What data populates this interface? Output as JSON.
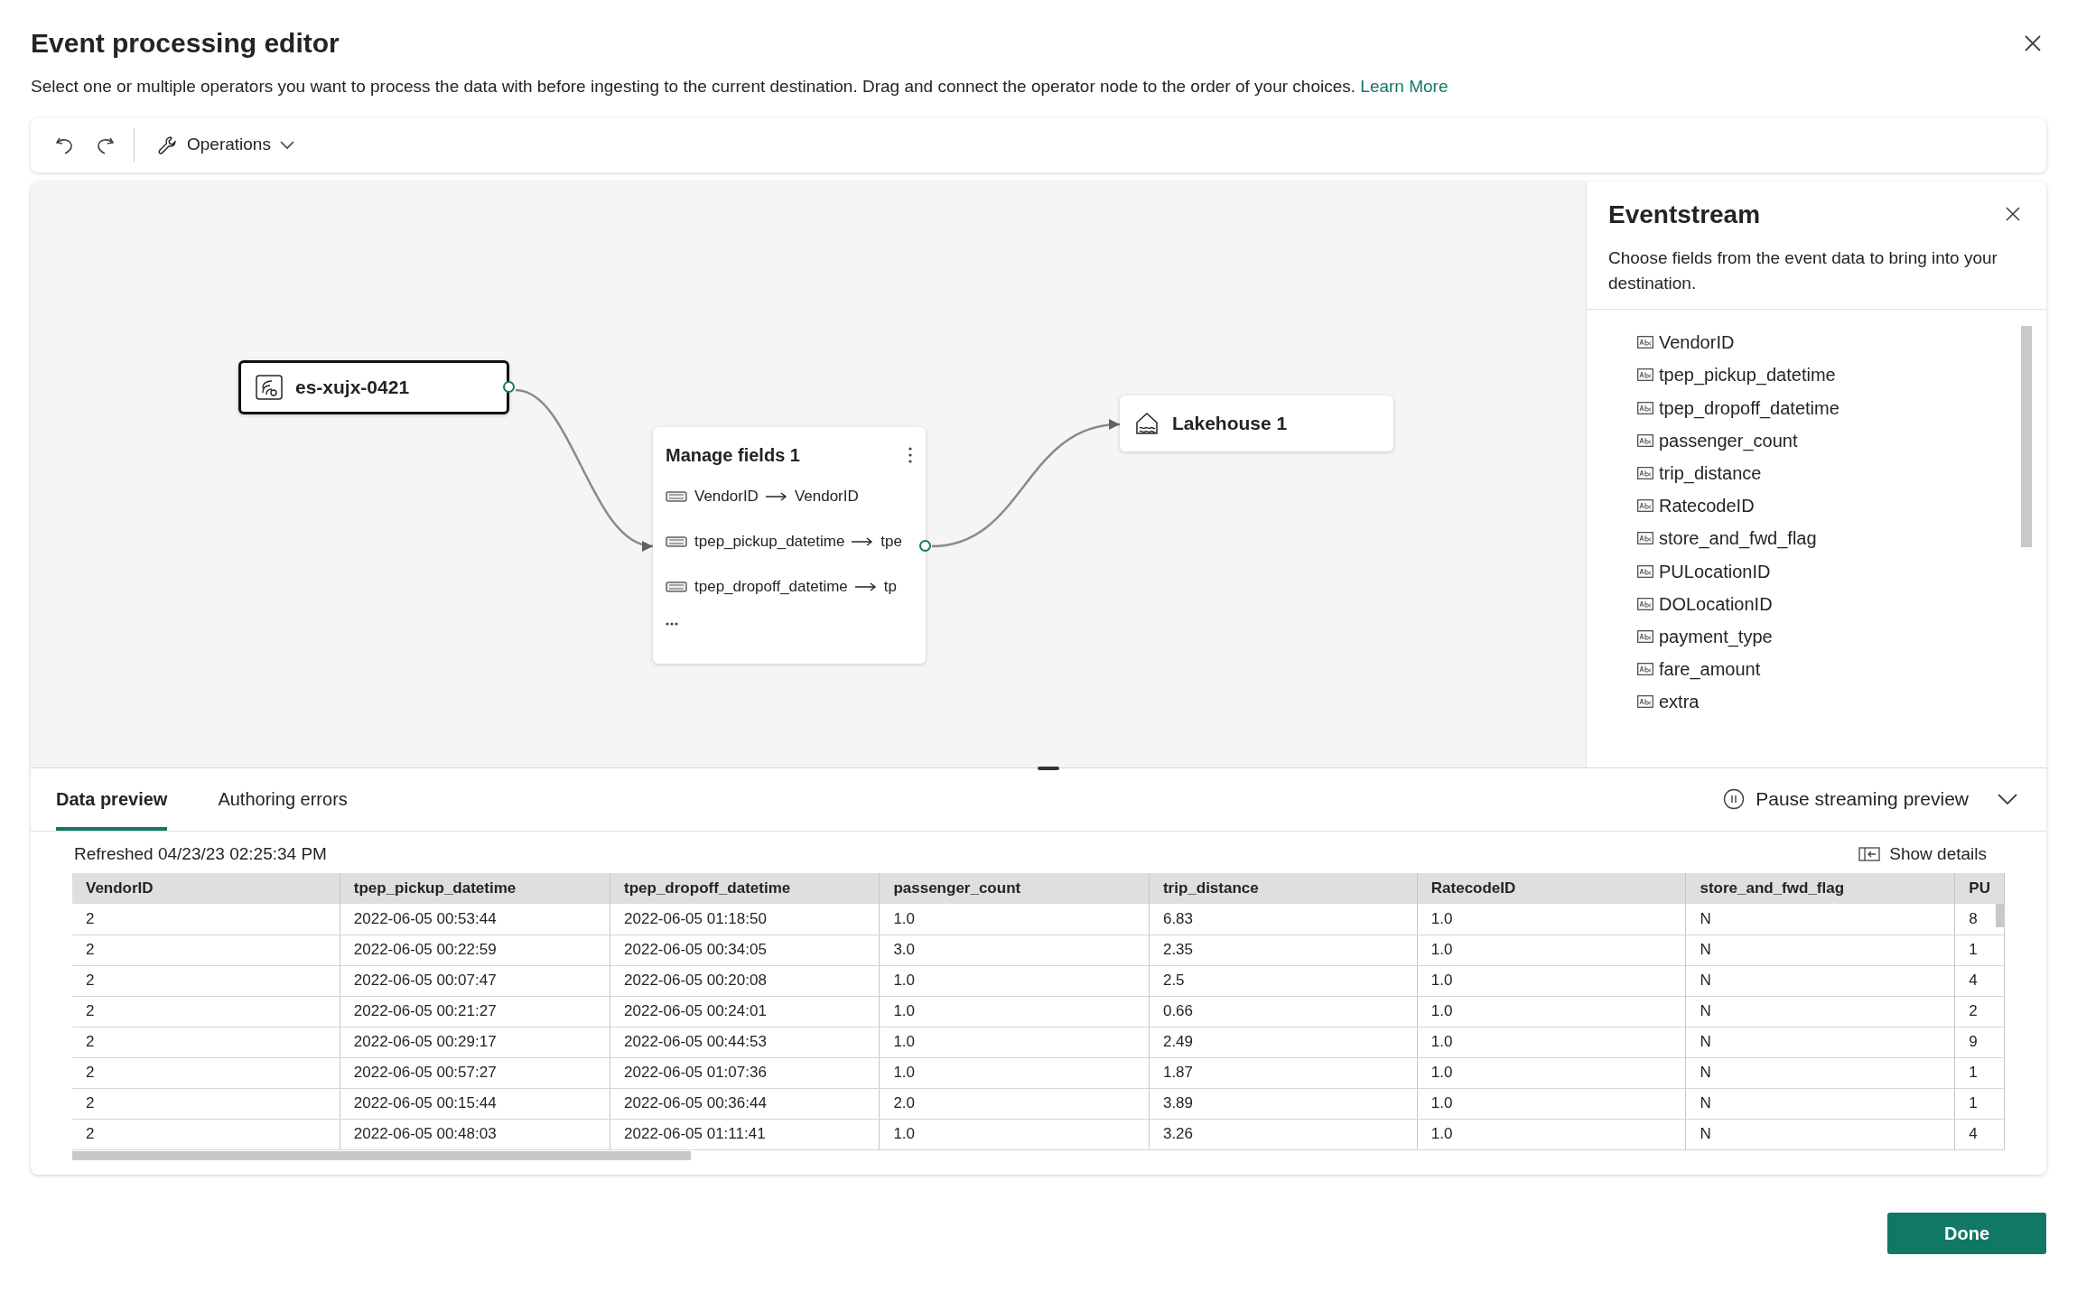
{
  "dialog": {
    "title": "Event processing editor",
    "description": "Select one or multiple operators you want to process the data with before ingesting to the current destination. Drag and connect the operator node to the order of your choices.",
    "learn_more": "Learn More"
  },
  "toolbar": {
    "operations": "Operations"
  },
  "canvas": {
    "nodes": [
      {
        "kind": "source",
        "label": "es-xujx-0421",
        "selected": true
      },
      {
        "kind": "operator",
        "label": "Manage fields 1",
        "selected": false,
        "fields": [
          {
            "source": "VendorID",
            "target": "VendorID"
          },
          {
            "source": "tpep_pickup_datetime",
            "target": "tpe"
          },
          {
            "source": "tpep_dropoff_datetime",
            "target": "tp"
          }
        ]
      },
      {
        "kind": "destination",
        "label": "Lakehouse 1",
        "selected": false
      }
    ]
  },
  "side_panel": {
    "title": "Eventstream",
    "description": "Choose fields from the event data to bring into your destination.",
    "fields": [
      "VendorID",
      "tpep_pickup_datetime",
      "tpep_dropoff_datetime",
      "passenger_count",
      "trip_distance",
      "RatecodeID",
      "store_and_fwd_flag",
      "PULocationID",
      "DOLocationID",
      "payment_type",
      "fare_amount",
      "extra"
    ]
  },
  "bottom_panel": {
    "tabs": [
      {
        "label": "Data preview",
        "selected": true
      },
      {
        "label": "Authoring errors",
        "selected": false
      }
    ],
    "pause": "Pause streaming preview",
    "refreshed": "Refreshed 04/23/23 02:25:34 PM",
    "show_details": "Show details",
    "table": {
      "columns": [
        "VendorID",
        "tpep_pickup_datetime",
        "tpep_dropoff_datetime",
        "passenger_count",
        "trip_distance",
        "RatecodeID",
        "store_and_fwd_flag",
        "PU"
      ],
      "rows": [
        [
          "2",
          "2022-06-05 00:53:44",
          "2022-06-05 01:18:50",
          "1.0",
          "6.83",
          "1.0",
          "N",
          "8"
        ],
        [
          "2",
          "2022-06-05 00:22:59",
          "2022-06-05 00:34:05",
          "3.0",
          "2.35",
          "1.0",
          "N",
          "1"
        ],
        [
          "2",
          "2022-06-05 00:07:47",
          "2022-06-05 00:20:08",
          "1.0",
          "2.5",
          "1.0",
          "N",
          "4"
        ],
        [
          "2",
          "2022-06-05 00:21:27",
          "2022-06-05 00:24:01",
          "1.0",
          "0.66",
          "1.0",
          "N",
          "2"
        ],
        [
          "2",
          "2022-06-05 00:29:17",
          "2022-06-05 00:44:53",
          "1.0",
          "2.49",
          "1.0",
          "N",
          "9"
        ],
        [
          "2",
          "2022-06-05 00:57:27",
          "2022-06-05 01:07:36",
          "1.0",
          "1.87",
          "1.0",
          "N",
          "1"
        ],
        [
          "2",
          "2022-06-05 00:15:44",
          "2022-06-05 00:36:44",
          "2.0",
          "3.89",
          "1.0",
          "N",
          "1"
        ],
        [
          "2",
          "2022-06-05 00:48:03",
          "2022-06-05 01:11:41",
          "1.0",
          "3.26",
          "1.0",
          "N",
          "4"
        ]
      ]
    }
  },
  "done_button": "Done"
}
